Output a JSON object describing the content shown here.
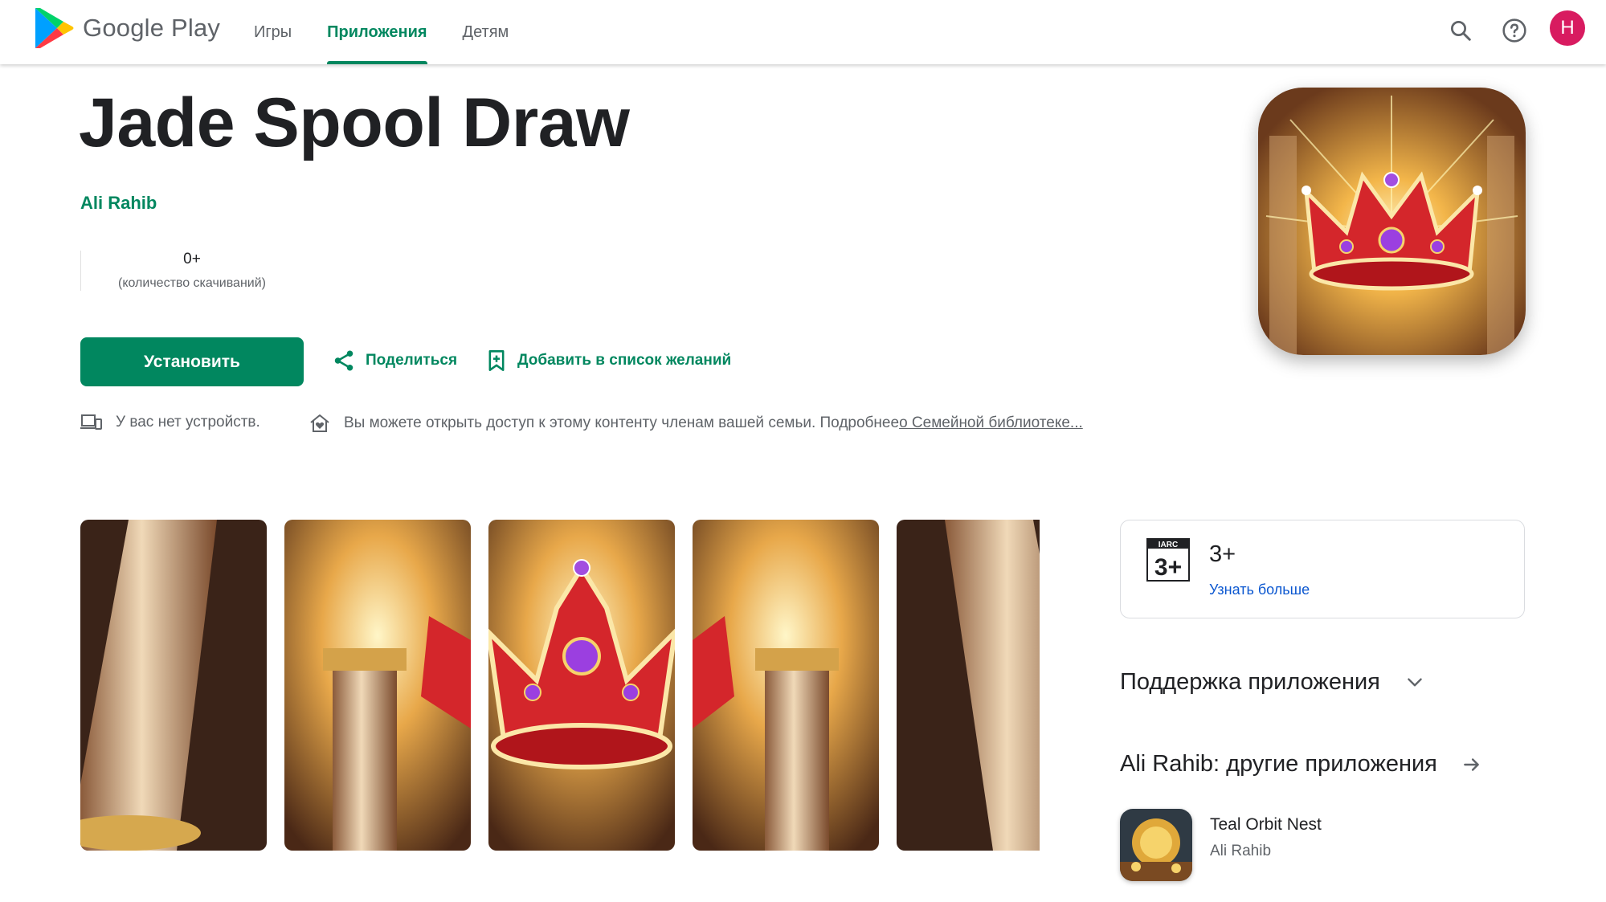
{
  "header": {
    "brand": "Google Play",
    "tabs": [
      {
        "label": "Игры",
        "active": false
      },
      {
        "label": "Приложения",
        "active": true
      },
      {
        "label": "Детям",
        "active": false
      }
    ],
    "icons": [
      "search-icon",
      "help-icon"
    ],
    "avatar_letter": "H"
  },
  "app": {
    "title": "Jade Spool Draw",
    "developer": "Ali Rahib",
    "stats": {
      "downloads_value": "0+",
      "downloads_label": "(количество скачиваний)"
    },
    "install_label": "Установить",
    "share_label": "Поделиться",
    "wishlist_label": "Добавить в список желаний",
    "device_note": "У вас нет устройств.",
    "family_note": "Вы можете открыть доступ к этому контенту членам вашей семьи. Подробнее",
    "family_link": "о Семейной библиотеке..."
  },
  "screenshots_count": 5,
  "rating": {
    "badge_top": "IARC",
    "badge_value": "3+",
    "value": "3+",
    "learn_more": "Узнать больше"
  },
  "support": {
    "title": "Поддержка приложения"
  },
  "more_by": {
    "title": "Ali Rahib: другие приложения",
    "apps": [
      {
        "name": "Teal Orbit Nest",
        "developer": "Ali Rahib"
      }
    ]
  },
  "colors": {
    "accent": "#01875f",
    "link_blue": "#0b57d0",
    "avatar": "#d81b60",
    "text": "#202124",
    "muted": "#5f6368"
  }
}
